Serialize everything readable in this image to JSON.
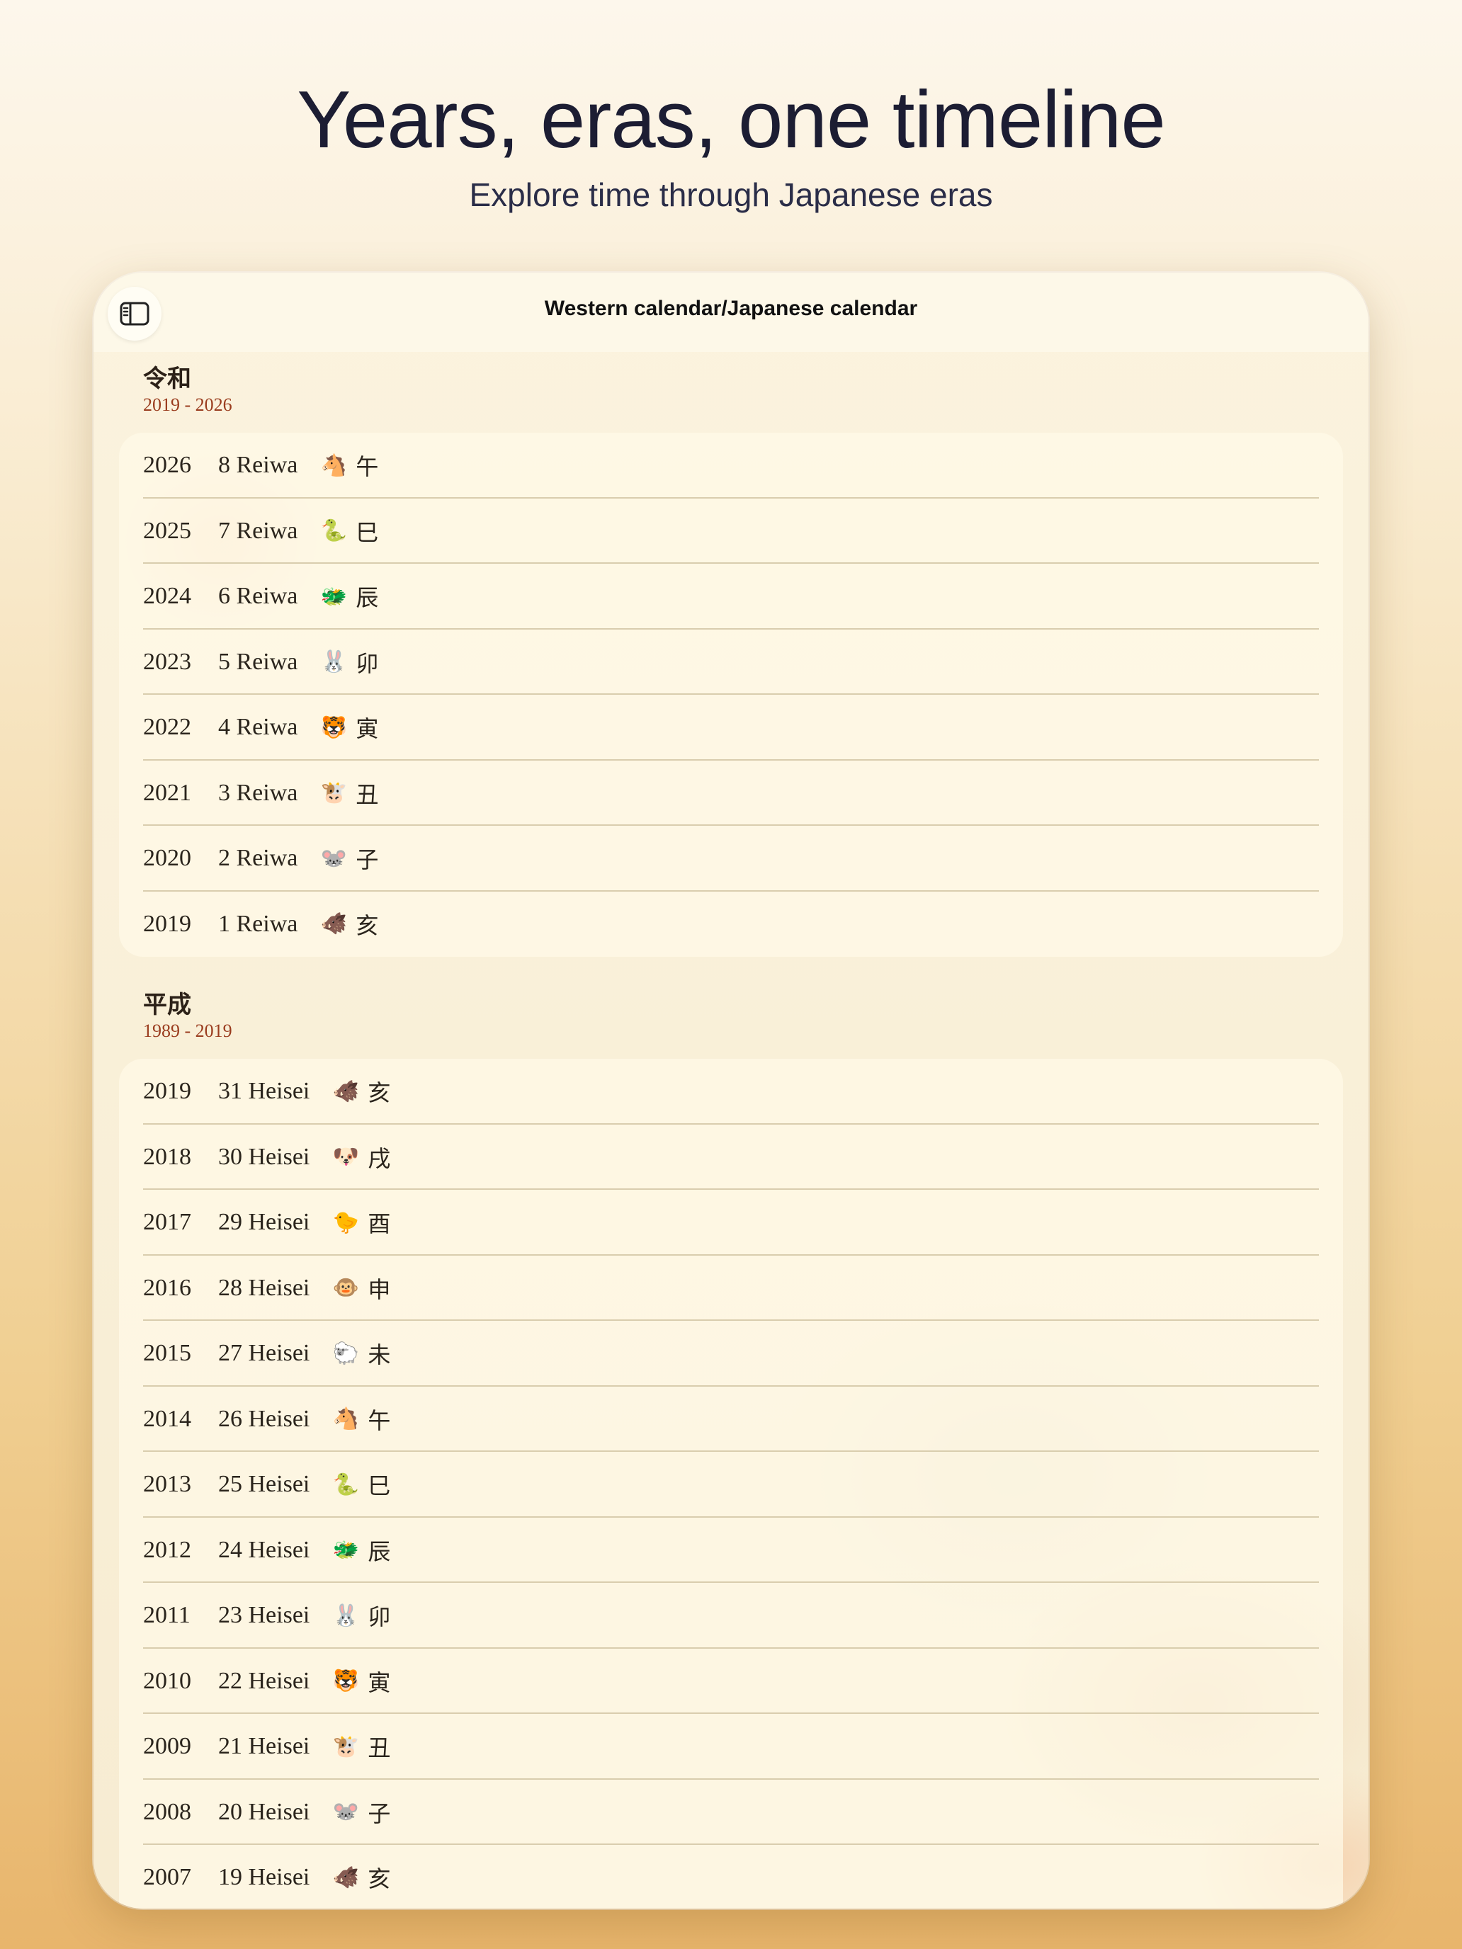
{
  "hero": {
    "title": "Years, eras, one timeline",
    "subtitle": "Explore time through Japanese eras"
  },
  "nav": {
    "title": "Western calendar/Japanese calendar",
    "sidebar_icon": "sidebar-toggle-icon"
  },
  "eras": [
    {
      "name": "令和",
      "range": "2019 - 2026",
      "rows": [
        {
          "year": "2026",
          "era_year": "8 Reiwa",
          "animal": "🐴",
          "kanji": "午"
        },
        {
          "year": "2025",
          "era_year": "7 Reiwa",
          "animal": "🐍",
          "kanji": "巳"
        },
        {
          "year": "2024",
          "era_year": "6 Reiwa",
          "animal": "🐲",
          "kanji": "辰"
        },
        {
          "year": "2023",
          "era_year": "5 Reiwa",
          "animal": "🐰",
          "kanji": "卯"
        },
        {
          "year": "2022",
          "era_year": "4 Reiwa",
          "animal": "🐯",
          "kanji": "寅"
        },
        {
          "year": "2021",
          "era_year": "3 Reiwa",
          "animal": "🐮",
          "kanji": "丑"
        },
        {
          "year": "2020",
          "era_year": "2 Reiwa",
          "animal": "🐭",
          "kanji": "子"
        },
        {
          "year": "2019",
          "era_year": "1 Reiwa",
          "animal": "🐗",
          "kanji": "亥"
        }
      ]
    },
    {
      "name": "平成",
      "range": "1989 - 2019",
      "rows": [
        {
          "year": "2019",
          "era_year": "31 Heisei",
          "animal": "🐗",
          "kanji": "亥"
        },
        {
          "year": "2018",
          "era_year": "30 Heisei",
          "animal": "🐶",
          "kanji": "戌"
        },
        {
          "year": "2017",
          "era_year": "29 Heisei",
          "animal": "🐤",
          "kanji": "酉"
        },
        {
          "year": "2016",
          "era_year": "28 Heisei",
          "animal": "🐵",
          "kanji": "申"
        },
        {
          "year": "2015",
          "era_year": "27 Heisei",
          "animal": "🐑",
          "kanji": "未"
        },
        {
          "year": "2014",
          "era_year": "26 Heisei",
          "animal": "🐴",
          "kanji": "午"
        },
        {
          "year": "2013",
          "era_year": "25 Heisei",
          "animal": "🐍",
          "kanji": "巳"
        },
        {
          "year": "2012",
          "era_year": "24 Heisei",
          "animal": "🐲",
          "kanji": "辰"
        },
        {
          "year": "2011",
          "era_year": "23 Heisei",
          "animal": "🐰",
          "kanji": "卯"
        },
        {
          "year": "2010",
          "era_year": "22 Heisei",
          "animal": "🐯",
          "kanji": "寅"
        },
        {
          "year": "2009",
          "era_year": "21 Heisei",
          "animal": "🐮",
          "kanji": "丑"
        },
        {
          "year": "2008",
          "era_year": "20 Heisei",
          "animal": "🐭",
          "kanji": "子"
        },
        {
          "year": "2007",
          "era_year": "19 Heisei",
          "animal": "🐗",
          "kanji": "亥"
        }
      ]
    }
  ]
}
